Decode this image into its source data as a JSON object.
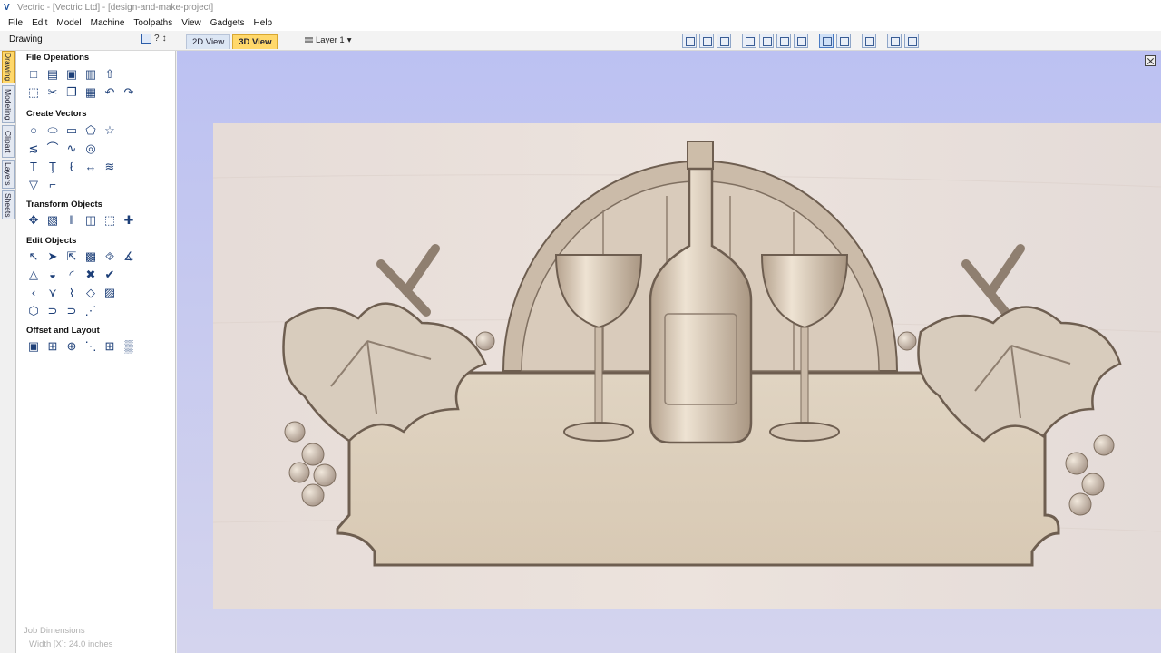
{
  "window": {
    "title": "Vectric - [Vectric Ltd] - [design-and-make-project]"
  },
  "menu": [
    "File",
    "Edit",
    "Model",
    "Machine",
    "Toolpaths",
    "View",
    "Gadgets",
    "Help"
  ],
  "toolbar": {
    "panel_title": "Drawing",
    "help_glyph": "?",
    "pin_glyph": "↕",
    "tabs": [
      {
        "label": "2D View",
        "active": false
      },
      {
        "label": "3D View",
        "active": true
      }
    ],
    "layer_label": "Layer 1",
    "layer_caret": "▾"
  },
  "side_tabs": [
    {
      "label": "Drawing",
      "active": true
    },
    {
      "label": "Modeling",
      "active": false
    },
    {
      "label": "Clipart",
      "active": false
    },
    {
      "label": "Layers",
      "active": false
    },
    {
      "label": "Sheets",
      "active": false
    }
  ],
  "sections": [
    {
      "title": "File Operations",
      "rows": [
        [
          "new-file-icon",
          "open-file-icon",
          "save-icon",
          "open-folder-icon",
          "import-icon"
        ],
        [
          "select-box-icon",
          "cut-icon",
          "copy-icon",
          "paste-icon",
          "undo-icon",
          "redo-icon"
        ]
      ]
    },
    {
      "title": "Create Vectors",
      "rows": [
        [
          "circle-icon",
          "ellipse-icon",
          "rectangle-icon",
          "polygon-icon",
          "star-icon"
        ],
        [
          "polyline-icon",
          "arc-icon",
          "curve-icon",
          "spiral-icon"
        ],
        [
          "text-icon",
          "text-on-curve-icon",
          "auto-layout-text-icon",
          "dimension-icon",
          "trace-bitmap-icon"
        ],
        [
          "draw-tangent-icon",
          "slot-icon"
        ]
      ]
    },
    {
      "title": "Transform Objects",
      "rows": [
        [
          "move-icon",
          "scale-icon",
          "mirror-icon",
          "align-icon",
          "distort-icon",
          "center-icon"
        ]
      ]
    },
    {
      "title": "Edit Objects",
      "rows": [
        [
          "select-icon",
          "node-edit-icon",
          "interactive-select-icon",
          "group-icon",
          "ungroup-icon",
          "join-icon"
        ],
        [
          "weld-icon",
          "subtract-icon",
          "fillet-icon",
          "trim-icon",
          "extend-icon"
        ],
        [
          "chevron-icon",
          "corner-icon",
          "bend-icon",
          "flip-icon",
          "image-icon"
        ],
        [
          "close-vector-icon",
          "join-open-icon",
          "arrange-icon",
          "measure-icon"
        ]
      ]
    },
    {
      "title": "Offset and Layout",
      "rows": [
        [
          "offset-icon",
          "array-copy-icon",
          "circular-copy-icon",
          "step-repeat-icon",
          "nesting-icon",
          "fit-icon"
        ]
      ]
    }
  ],
  "icon_glyphs": {
    "new-file-icon": "□",
    "open-file-icon": "▤",
    "save-icon": "▣",
    "open-folder-icon": "▥",
    "import-icon": "⇧",
    "select-box-icon": "⬚",
    "cut-icon": "✂",
    "copy-icon": "❐",
    "paste-icon": "▦",
    "undo-icon": "↶",
    "redo-icon": "↷",
    "circle-icon": "○",
    "ellipse-icon": "⬭",
    "rectangle-icon": "▭",
    "polygon-icon": "⬠",
    "star-icon": "☆",
    "polyline-icon": "≲",
    "arc-icon": "⌒",
    "curve-icon": "∿",
    "spiral-icon": "◎",
    "text-icon": "T",
    "text-on-curve-icon": "Ţ",
    "auto-layout-text-icon": "ℓ",
    "dimension-icon": "↔",
    "trace-bitmap-icon": "≋",
    "draw-tangent-icon": "▽",
    "slot-icon": "⌐",
    "move-icon": "✥",
    "scale-icon": "▧",
    "mirror-icon": "‖",
    "align-icon": "◫",
    "distort-icon": "⬚",
    "center-icon": "✚",
    "select-icon": "↖",
    "node-edit-icon": "➤",
    "interactive-select-icon": "⇱",
    "group-icon": "▩",
    "ungroup-icon": "⯑",
    "join-icon": "∡",
    "weld-icon": "△",
    "subtract-icon": "◒",
    "fillet-icon": "◜",
    "trim-icon": "✖",
    "extend-icon": "✔",
    "chevron-icon": "‹",
    "corner-icon": "⋎",
    "bend-icon": "⌇",
    "flip-icon": "◇",
    "image-icon": "▨",
    "close-vector-icon": "⬡",
    "join-open-icon": "⊃",
    "arrange-icon": "⊃",
    "measure-icon": "⋰",
    "offset-icon": "▣",
    "array-copy-icon": "⊞",
    "circular-copy-icon": "⊕",
    "step-repeat-icon": "⋱",
    "nesting-icon": "⊞",
    "fit-icon": "▒"
  },
  "job": {
    "heading": "Job Dimensions",
    "width_text": "Width  [X]: 24.0 inches"
  },
  "colors": {
    "viewport_bg": "#c4c8f0",
    "material": "#e8ddd8",
    "relief_light": "#ded3c4",
    "relief_mid": "#c9b9a6",
    "relief_dark": "#7f6f60",
    "accent_tab": "#ffd86b"
  }
}
